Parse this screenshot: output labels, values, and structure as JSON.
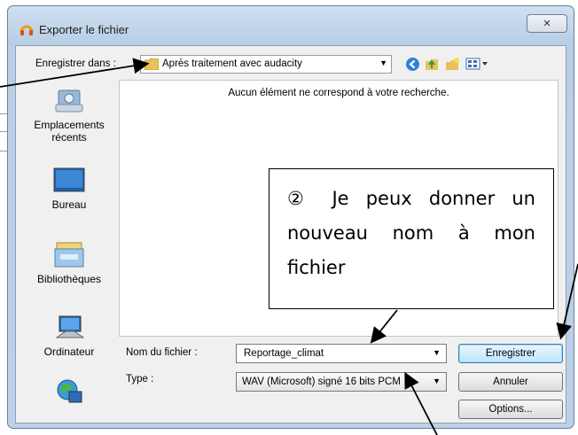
{
  "window": {
    "title": "Exporter le fichier",
    "close_glyph": "✕"
  },
  "lookin": {
    "label": "Enregistrer dans :",
    "value": "Après traitement avec audacity"
  },
  "toolbar": {
    "icons": [
      "back-icon",
      "up-folder-icon",
      "new-folder-icon",
      "view-menu-icon"
    ]
  },
  "places": [
    {
      "label": "Emplacements récents",
      "icon": "recent-places-icon"
    },
    {
      "label": "Bureau",
      "icon": "desktop-icon"
    },
    {
      "label": "Bibliothèques",
      "icon": "libraries-icon"
    },
    {
      "label": "Ordinateur",
      "icon": "computer-icon"
    },
    {
      "label": "",
      "icon": "network-icon"
    }
  ],
  "filelist": {
    "empty_message": "Aucun élément ne correspond à votre recherche."
  },
  "filename": {
    "label": "Nom du fichier :",
    "value": "Reportage_climat"
  },
  "filetype": {
    "label": "Type :",
    "value": "WAV (Microsoft) signé 16 bits PCM"
  },
  "buttons": {
    "save": "Enregistrer",
    "cancel": "Annuler",
    "options": "Options..."
  },
  "annotation": {
    "text": "② Je peux donner un nouveau nom à mon fichier"
  }
}
